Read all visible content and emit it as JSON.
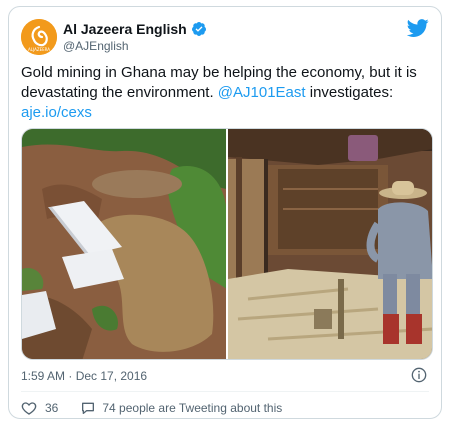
{
  "tweet": {
    "author_name": "Al Jazeera English",
    "author_handle": "@AJEnglish",
    "text_part1": "Gold mining in Ghana may be helping the economy, but it is devastating the environment. ",
    "mention": "@AJ101East",
    "text_part2": " investigates:",
    "link": "aje.io/cexs",
    "timestamp": "1:59 AM · Dec 17, 2016",
    "likes": "36",
    "tweeting_text": "74 people are Tweeting about this"
  },
  "colors": {
    "link": "#1d9bf0",
    "avatar_bg": "#f29a1c",
    "verified": "#1d9bf0"
  },
  "icons": {
    "avatar": "al-jazeera-logo-icon",
    "verified": "verified-badge-icon",
    "brand": "twitter-bird-icon",
    "info": "info-icon",
    "like": "heart-icon",
    "reply": "speech-bubble-icon"
  }
}
